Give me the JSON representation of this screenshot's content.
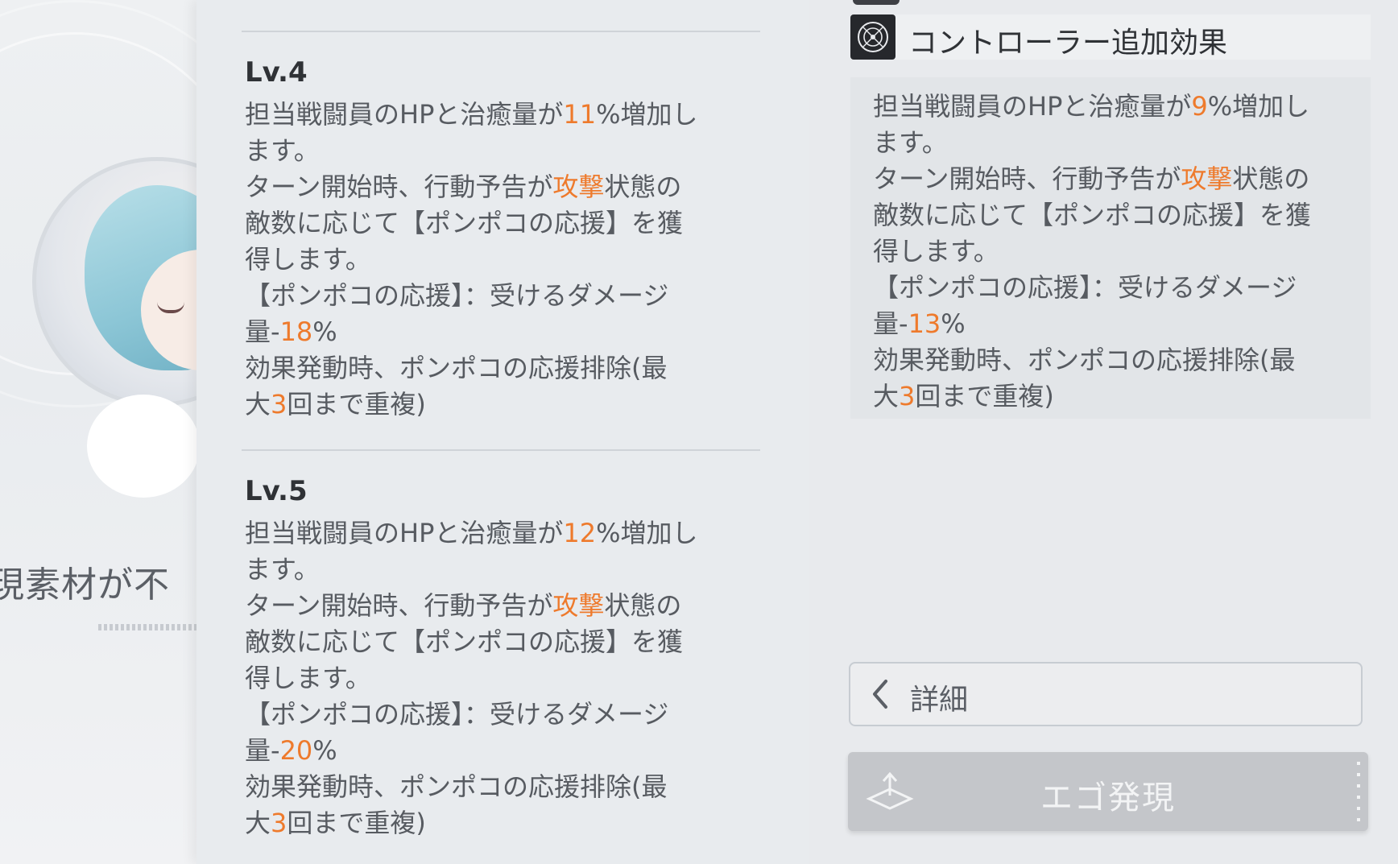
{
  "background": {
    "partial_text": "現素材が不"
  },
  "levels": [
    {
      "title": "Lv.4",
      "lines": [
        [
          {
            "t": "担当戦闘員のHPと治癒量が"
          },
          {
            "t": "11",
            "h": true
          },
          {
            "t": "%増加し"
          }
        ],
        [
          {
            "t": "ます。"
          }
        ],
        [
          {
            "t": "ターン開始時、行動予告が"
          },
          {
            "t": "攻撃",
            "h": true
          },
          {
            "t": "状態の"
          }
        ],
        [
          {
            "t": "敵数に応じて【ポンポコの応援】を獲"
          }
        ],
        [
          {
            "t": "得します。"
          }
        ],
        [
          {
            "t": "【ポンポコの応援】：受けるダメージ"
          }
        ],
        [
          {
            "t": "量-"
          },
          {
            "t": "18",
            "h": true
          },
          {
            "t": "%"
          }
        ],
        [
          {
            "t": "効果発動時、ポンポコの応援排除(最"
          }
        ],
        [
          {
            "t": "大"
          },
          {
            "t": "3",
            "h": true
          },
          {
            "t": "回まで重複)"
          }
        ]
      ]
    },
    {
      "title": "Lv.5",
      "lines": [
        [
          {
            "t": "担当戦闘員のHPと治癒量が"
          },
          {
            "t": "12",
            "h": true
          },
          {
            "t": "%増加し"
          }
        ],
        [
          {
            "t": "ます。"
          }
        ],
        [
          {
            "t": "ターン開始時、行動予告が"
          },
          {
            "t": "攻撃",
            "h": true
          },
          {
            "t": "状態の"
          }
        ],
        [
          {
            "t": "敵数に応じて【ポンポコの応援】を獲"
          }
        ],
        [
          {
            "t": "得します。"
          }
        ],
        [
          {
            "t": "【ポンポコの応援】：受けるダメージ"
          }
        ],
        [
          {
            "t": "量-"
          },
          {
            "t": "20",
            "h": true
          },
          {
            "t": "%"
          }
        ],
        [
          {
            "t": "効果発動時、ポンポコの応援排除(最"
          }
        ],
        [
          {
            "t": "大"
          },
          {
            "t": "3",
            "h": true
          },
          {
            "t": "回まで重複)"
          }
        ]
      ]
    }
  ],
  "controller": {
    "title": "コントローラー追加効果",
    "icon": "target-emblem-icon",
    "lines": [
      [
        {
          "t": "担当戦闘員のHPと治癒量が"
        },
        {
          "t": "9",
          "h": true
        },
        {
          "t": "%増加し"
        }
      ],
      [
        {
          "t": "ます。"
        }
      ],
      [
        {
          "t": "ターン開始時、行動予告が"
        },
        {
          "t": "攻撃",
          "h": true
        },
        {
          "t": "状態の"
        }
      ],
      [
        {
          "t": "敵数に応じて【ポンポコの応援】を獲"
        }
      ],
      [
        {
          "t": "得します。"
        }
      ],
      [
        {
          "t": "【ポンポコの応援】：受けるダメージ"
        }
      ],
      [
        {
          "t": "量-"
        },
        {
          "t": "13",
          "h": true
        },
        {
          "t": "%"
        }
      ],
      [
        {
          "t": "効果発動時、ポンポコの応援排除(最"
        }
      ],
      [
        {
          "t": "大"
        },
        {
          "t": "3",
          "h": true
        },
        {
          "t": "回まで重複)"
        }
      ]
    ]
  },
  "buttons": {
    "detail_label": "詳細",
    "ego_label": "エゴ発現"
  },
  "colors": {
    "highlight": "#ee7a2c",
    "text": "#575b61",
    "panel": "#e8ebee"
  }
}
